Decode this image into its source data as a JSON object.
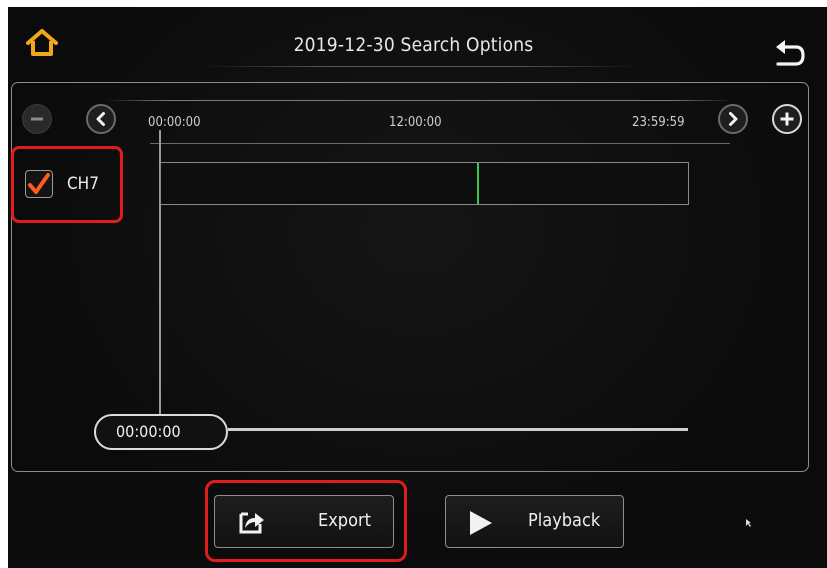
{
  "header": {
    "title": "2019-12-30 Search Options"
  },
  "timeline": {
    "ticks": [
      "00:00:00",
      "12:00:00",
      "23:59:59"
    ],
    "recording_position": 0.6
  },
  "channel": {
    "label": "CH7",
    "checked": true
  },
  "slider": {
    "time": "00:00:00"
  },
  "actions": {
    "export_label": "Export",
    "playback_label": "Playback"
  },
  "colors": {
    "home_icon": "#f0a81a",
    "checkmark": "#ff5a1f",
    "recording": "#3cc64a",
    "highlight": "#e11c1c"
  },
  "icons": [
    "home-icon",
    "back-arrow-icon",
    "minus-icon",
    "chevron-left-icon",
    "chevron-right-icon",
    "plus-icon",
    "checkmark-icon",
    "export-icon",
    "play-icon"
  ]
}
